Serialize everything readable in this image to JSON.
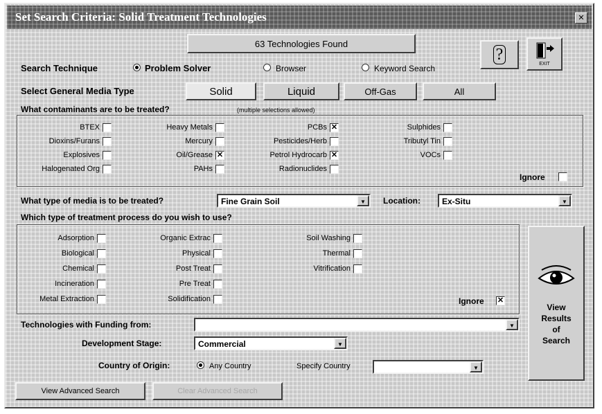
{
  "window": {
    "title": "Set Search Criteria: Solid Treatment Technologies",
    "close_glyph": "✕"
  },
  "found": {
    "label": "63 Technologies Found"
  },
  "toolbar": {
    "help_glyph": "?",
    "exit_label": "EXIT"
  },
  "search_technique": {
    "label": "Search Technique",
    "options": [
      {
        "label": "Problem Solver",
        "selected": true
      },
      {
        "label": "Browser",
        "selected": false
      },
      {
        "label": "Keyword Search",
        "selected": false
      }
    ]
  },
  "media_type": {
    "label": "Select General Media Type",
    "options": [
      {
        "label": "Solid",
        "selected": true
      },
      {
        "label": "Liquid",
        "selected": false
      },
      {
        "label": "Off-Gas",
        "selected": false
      },
      {
        "label": "All",
        "selected": false
      }
    ]
  },
  "contaminants": {
    "label": "What contaminants are to be treated?",
    "hint": "(multiple selections allowed)",
    "items": [
      {
        "label": "BTEX",
        "checked": false
      },
      {
        "label": "Dioxins/Furans",
        "checked": false
      },
      {
        "label": "Explosives",
        "checked": false
      },
      {
        "label": "Halogenated Org",
        "checked": false
      },
      {
        "label": "Heavy Metals",
        "checked": false
      },
      {
        "label": "Mercury",
        "checked": false
      },
      {
        "label": "Oil/Grease",
        "checked": true
      },
      {
        "label": "PAHs",
        "checked": false
      },
      {
        "label": "PCBs",
        "checked": true
      },
      {
        "label": "Pesticides/Herb",
        "checked": false
      },
      {
        "label": "Petrol Hydrocarb",
        "checked": true
      },
      {
        "label": "Radionuclides",
        "checked": false
      },
      {
        "label": "Sulphides",
        "checked": false
      },
      {
        "label": "Tributyl Tin",
        "checked": false
      },
      {
        "label": "VOCs",
        "checked": false
      }
    ],
    "ignore": {
      "label": "Ignore",
      "checked": false
    }
  },
  "media": {
    "label": "What type of media is to be treated?",
    "value": "Fine Grain Soil"
  },
  "location": {
    "label": "Location:",
    "value": "Ex-Situ"
  },
  "process": {
    "label": "Which type of treatment process do you wish to use?",
    "items": [
      {
        "label": "Adsorption",
        "checked": false
      },
      {
        "label": "Biological",
        "checked": false
      },
      {
        "label": "Chemical",
        "checked": false
      },
      {
        "label": "Incineration",
        "checked": false
      },
      {
        "label": "Metal Extraction",
        "checked": false
      },
      {
        "label": "Organic Extrac",
        "checked": false
      },
      {
        "label": "Physical",
        "checked": false
      },
      {
        "label": "Post Treat",
        "checked": false
      },
      {
        "label": "Pre Treat",
        "checked": false
      },
      {
        "label": "Solidification",
        "checked": false
      },
      {
        "label": "Soil Washing",
        "checked": false
      },
      {
        "label": "Thermal",
        "checked": false
      },
      {
        "label": "Vitrification",
        "checked": false
      }
    ],
    "ignore": {
      "label": "Ignore",
      "checked": true
    }
  },
  "funding": {
    "label": "Technologies with Funding from:",
    "value": ""
  },
  "stage": {
    "label": "Development Stage:",
    "value": "Commercial"
  },
  "origin": {
    "label": "Country of Origin:",
    "any_label": "Any Country",
    "any_selected": true,
    "specify_label": "Specify Country",
    "specify_value": ""
  },
  "view_results": {
    "line1": "View",
    "line2": "Results",
    "line3": "of",
    "line4": "Search"
  },
  "buttons": {
    "advanced": "View Advanced Search",
    "clear": "Clear Advanced Search"
  },
  "glyphs": {
    "check": "✕",
    "arrow": "▼"
  }
}
